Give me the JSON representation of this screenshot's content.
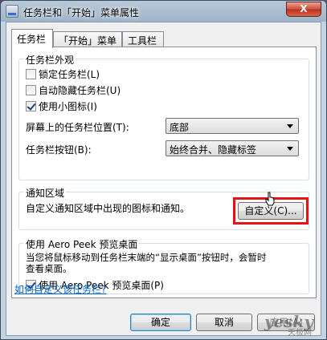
{
  "window": {
    "title": "任务栏和「开始」菜单属性",
    "close_label": "X"
  },
  "tabs": [
    {
      "label": "任务栏"
    },
    {
      "label": "「开始」菜单"
    },
    {
      "label": "工具栏"
    }
  ],
  "appearance": {
    "group_title": "任务栏外观",
    "lock_taskbar": {
      "label": "锁定任务栏(L)",
      "checked": false
    },
    "auto_hide": {
      "label": "自动隐藏任务栏(U)",
      "checked": false
    },
    "small_icons": {
      "label": "使用小图标(I)",
      "checked": true
    },
    "location_label": "屏幕上的任务栏位置(T):",
    "location_value": "底部",
    "buttons_label": "任务栏按钮(B):",
    "buttons_value": "始终合并、隐藏标签"
  },
  "notification": {
    "group_title": "通知区域",
    "description": "自定义通知区域中出现的图标和通知。",
    "customize_button": "自定义(C)..."
  },
  "aero_peek": {
    "group_title": "使用 Aero Peek 预览桌面",
    "description_line1": "当您将鼠标移动到任务栏末端的“显示桌面”按钮时，会暂时",
    "description_line2": "查看桌面。",
    "checkbox": {
      "label": "使用 Aero Peek 预览桌面(P)",
      "checked": true
    }
  },
  "help_link": "如何自定义该任务栏?",
  "footer": {
    "ok": "确定",
    "cancel": "取消",
    "apply": "应用(A)"
  },
  "watermark": {
    "brand": "yesky",
    "sub": "天极网"
  },
  "colors": {
    "highlight": "#e21414",
    "link": "#0066cc"
  }
}
